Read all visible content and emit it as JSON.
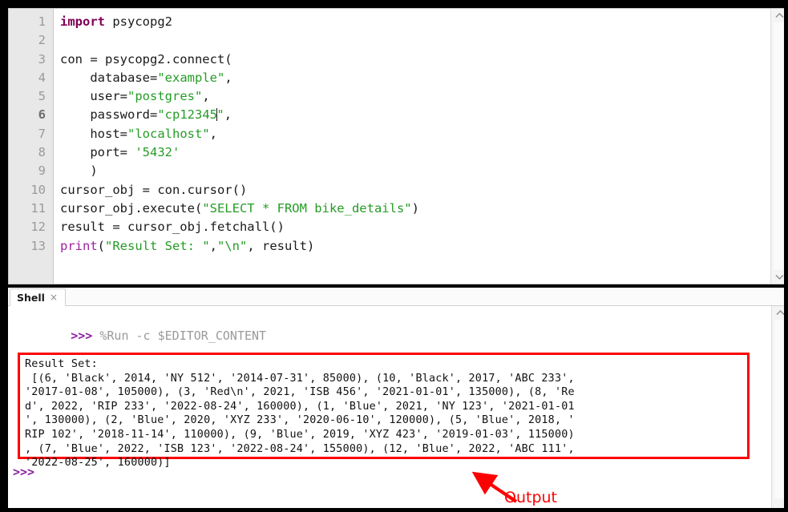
{
  "editor": {
    "line_numbers": [
      "1",
      "2",
      "3",
      "4",
      "5",
      "6",
      "7",
      "8",
      "9",
      "10",
      "11",
      "12",
      "13"
    ],
    "current_line": 6,
    "lines": [
      {
        "n": 1,
        "segments": [
          {
            "t": "import",
            "c": "kw"
          },
          {
            "t": " psycopg2",
            "c": "plain"
          }
        ]
      },
      {
        "n": 2,
        "segments": []
      },
      {
        "n": 3,
        "segments": [
          {
            "t": "con = psycopg2.connect(",
            "c": "plain"
          }
        ]
      },
      {
        "n": 4,
        "segments": [
          {
            "t": "    database=",
            "c": "plain"
          },
          {
            "t": "\"example\"",
            "c": "str"
          },
          {
            "t": ",",
            "c": "plain"
          }
        ]
      },
      {
        "n": 5,
        "segments": [
          {
            "t": "    user=",
            "c": "plain"
          },
          {
            "t": "\"postgres\"",
            "c": "str"
          },
          {
            "t": ",",
            "c": "plain"
          }
        ]
      },
      {
        "n": 6,
        "segments": [
          {
            "t": "    password=",
            "c": "plain"
          },
          {
            "t": "\"cp12345",
            "c": "str"
          },
          {
            "t": "|CARET|",
            "c": "caret"
          },
          {
            "t": "\"",
            "c": "str"
          },
          {
            "t": ",",
            "c": "plain"
          }
        ]
      },
      {
        "n": 7,
        "segments": [
          {
            "t": "    host=",
            "c": "plain"
          },
          {
            "t": "\"localhost\"",
            "c": "str"
          },
          {
            "t": ",",
            "c": "plain"
          }
        ]
      },
      {
        "n": 8,
        "segments": [
          {
            "t": "    port= ",
            "c": "plain"
          },
          {
            "t": "'5432'",
            "c": "str"
          }
        ]
      },
      {
        "n": 9,
        "segments": [
          {
            "t": "    )",
            "c": "plain"
          }
        ]
      },
      {
        "n": 10,
        "segments": [
          {
            "t": "cursor_obj = con.cursor()",
            "c": "plain"
          }
        ]
      },
      {
        "n": 11,
        "segments": [
          {
            "t": "cursor_obj.execute(",
            "c": "plain"
          },
          {
            "t": "\"SELECT * FROM bike_details\"",
            "c": "str"
          },
          {
            "t": ")",
            "c": "plain"
          }
        ]
      },
      {
        "n": 12,
        "segments": [
          {
            "t": "result = cursor_obj.fetchall()",
            "c": "plain"
          }
        ]
      },
      {
        "n": 13,
        "segments": [
          {
            "t": "print",
            "c": "builtin"
          },
          {
            "t": "(",
            "c": "plain"
          },
          {
            "t": "\"Result Set: \"",
            "c": "str"
          },
          {
            "t": ",",
            "c": "plain"
          },
          {
            "t": "\"\\n\"",
            "c": "str"
          },
          {
            "t": ", result)",
            "c": "plain"
          }
        ]
      }
    ]
  },
  "shell": {
    "tab_label": "Shell",
    "tab_close_icon": "×",
    "prompt": ">>>",
    "run_command": "%Run -c $EDITOR_CONTENT",
    "trailing_prompt": ">>>",
    "output_lines": [
      "Result Set:",
      " [(6, 'Black', 2014, 'NY 512', '2014-07-31', 85000), (10, 'Black', 2017, 'ABC 233',",
      "'2017-01-08', 105000), (3, 'Red\\n', 2021, 'ISB 456', '2021-01-01', 135000), (8, 'Re",
      "d', 2022, 'RIP 233', '2022-08-24', 160000), (1, 'Blue', 2021, 'NY 123', '2021-01-01",
      "', 130000), (2, 'Blue', 2020, 'XYZ 233', '2020-06-10', 120000), (5, 'Blue', 2018, '",
      "RIP 102', '2018-11-14', 110000), (9, 'Blue', 2019, 'XYZ 423', '2019-01-03', 115000)",
      ", (7, 'Blue', 2022, 'ISB 123', '2022-08-24', 155000), (12, 'Blue', 2022, 'ABC 111',",
      "'2022-08-25', 160000)]"
    ]
  },
  "annotation": {
    "label": "Output",
    "color": "#fe0000"
  },
  "scrollbars": {
    "up_arrow_icon": "chevron-up",
    "down_arrow_icon": "chevron-down"
  },
  "colors": {
    "keyword": "#7f0055",
    "builtin": "#a020a0",
    "string": "#259c25",
    "prompt": "#8b1f9e",
    "annotation": "#fe0000",
    "gutter_bg": "#e8e8e8"
  }
}
